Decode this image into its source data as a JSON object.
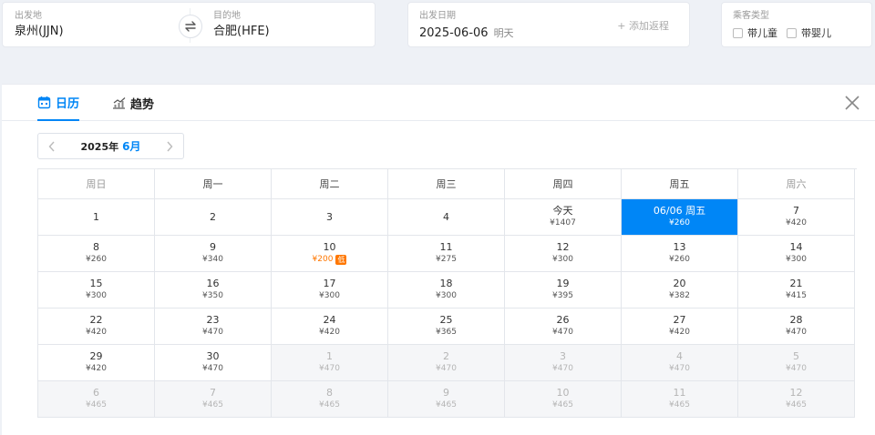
{
  "search": {
    "from": {
      "label": "出发地",
      "value": "泉州(JJN)"
    },
    "to": {
      "label": "目的地",
      "value": "合肥(HFE)"
    },
    "date": {
      "label": "出发日期",
      "value": "2025-06-06",
      "hint": "明天"
    },
    "add_return": "+ 添加返程",
    "passenger": {
      "label": "乘客类型",
      "options": [
        "带儿童",
        "带婴儿"
      ]
    }
  },
  "tabs": [
    {
      "label": "日历",
      "icon": "calendar-icon",
      "active": true
    },
    {
      "label": "趋势",
      "icon": "trend-chart-icon",
      "active": false
    }
  ],
  "calendar": {
    "year_label": "2025年",
    "month_label": "6月",
    "weekdays": [
      "周日",
      "周一",
      "周二",
      "周三",
      "周四",
      "周五",
      "周六"
    ],
    "low_badge": "低",
    "weeks": [
      [
        {
          "day": "1",
          "price": ""
        },
        {
          "day": "2",
          "price": ""
        },
        {
          "day": "3",
          "price": ""
        },
        {
          "day": "4",
          "price": ""
        },
        {
          "day": "今天",
          "price": "¥1407"
        },
        {
          "day": "06/06 周五",
          "price": "¥260",
          "selected": true
        },
        {
          "day": "7",
          "price": "¥420"
        }
      ],
      [
        {
          "day": "8",
          "price": "¥260"
        },
        {
          "day": "9",
          "price": "¥340"
        },
        {
          "day": "10",
          "price": "¥200",
          "lowest": true
        },
        {
          "day": "11",
          "price": "¥275"
        },
        {
          "day": "12",
          "price": "¥300"
        },
        {
          "day": "13",
          "price": "¥260"
        },
        {
          "day": "14",
          "price": "¥300"
        }
      ],
      [
        {
          "day": "15",
          "price": "¥300"
        },
        {
          "day": "16",
          "price": "¥350"
        },
        {
          "day": "17",
          "price": "¥300"
        },
        {
          "day": "18",
          "price": "¥300"
        },
        {
          "day": "19",
          "price": "¥395"
        },
        {
          "day": "20",
          "price": "¥382"
        },
        {
          "day": "21",
          "price": "¥415"
        }
      ],
      [
        {
          "day": "22",
          "price": "¥420"
        },
        {
          "day": "23",
          "price": "¥470"
        },
        {
          "day": "24",
          "price": "¥420"
        },
        {
          "day": "25",
          "price": "¥365"
        },
        {
          "day": "26",
          "price": "¥470"
        },
        {
          "day": "27",
          "price": "¥420"
        },
        {
          "day": "28",
          "price": "¥470"
        }
      ],
      [
        {
          "day": "29",
          "price": "¥420"
        },
        {
          "day": "30",
          "price": "¥470"
        },
        {
          "day": "1",
          "price": "¥470",
          "muted": true
        },
        {
          "day": "2",
          "price": "¥470",
          "muted": true
        },
        {
          "day": "3",
          "price": "¥470",
          "muted": true
        },
        {
          "day": "4",
          "price": "¥470",
          "muted": true
        },
        {
          "day": "5",
          "price": "¥470",
          "muted": true
        }
      ],
      [
        {
          "day": "6",
          "price": "¥465",
          "muted": true
        },
        {
          "day": "7",
          "price": "¥465",
          "muted": true
        },
        {
          "day": "8",
          "price": "¥465",
          "muted": true
        },
        {
          "day": "9",
          "price": "¥465",
          "muted": true
        },
        {
          "day": "10",
          "price": "¥465",
          "muted": true
        },
        {
          "day": "11",
          "price": "¥465",
          "muted": true
        },
        {
          "day": "12",
          "price": "¥465",
          "muted": true
        }
      ]
    ]
  },
  "colors": {
    "accent": "#0086f6",
    "lowest": "#ff7700",
    "muted_bg": "#f5f6f8"
  }
}
